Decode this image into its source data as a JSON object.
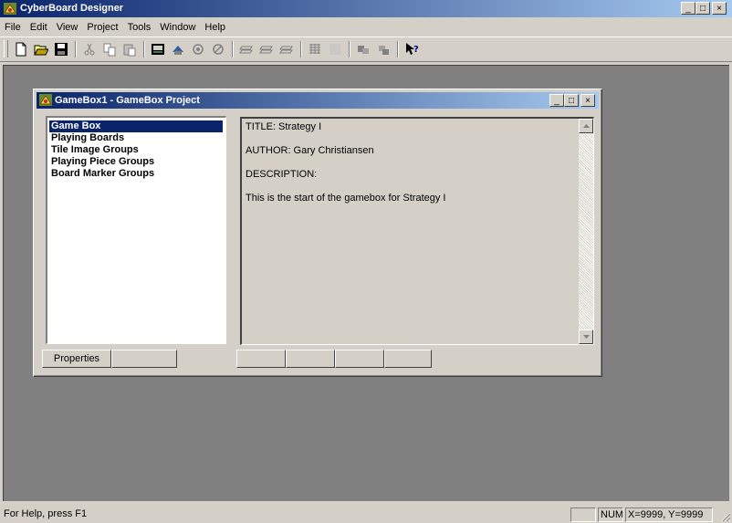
{
  "app": {
    "title": "CyberBoard Designer",
    "caption_buttons": {
      "minimize": "_",
      "maximize": "□",
      "close": "×"
    }
  },
  "menu": [
    "File",
    "Edit",
    "View",
    "Project",
    "Tools",
    "Window",
    "Help"
  ],
  "toolbar": {
    "buttons": [
      "new-icon",
      "open-icon",
      "save-icon",
      "cut-icon",
      "copy-icon",
      "paste-icon",
      "project-icon",
      "board-icon",
      "piece-icon",
      "marker-icon",
      "layer1-icon",
      "layer2-icon",
      "layer3-icon",
      "grid-icon",
      "fine-grid-icon",
      "select-icon",
      "move-icon",
      "help-context-icon"
    ]
  },
  "child_window": {
    "title": "GameBox1 - GameBox Project",
    "caption_buttons": {
      "minimize": "_",
      "maximize": "□",
      "close": "×"
    },
    "tree": [
      {
        "label": "Game Box",
        "selected": true
      },
      {
        "label": "Playing Boards",
        "selected": false
      },
      {
        "label": "Tile Image Groups",
        "selected": false
      },
      {
        "label": "Playing Piece Groups",
        "selected": false
      },
      {
        "label": "Board Marker Groups",
        "selected": false
      }
    ],
    "info": {
      "title_line": "TITLE: Strategy I",
      "author_line": "AUTHOR: Gary Christiansen",
      "description_label": "DESCRIPTION:",
      "description_text": "This is the start of the gamebox for Strategy I"
    },
    "left_buttons": [
      "Properties",
      ""
    ],
    "right_buttons": [
      "",
      "",
      "",
      ""
    ]
  },
  "status": {
    "help_text": "For Help, press F1",
    "num": "NUM",
    "coords": "X=9999, Y=9999"
  },
  "colors": {
    "titlebar_start": "#0a246a",
    "titlebar_end": "#a6caf0",
    "face": "#d4d0c8",
    "mdi_background": "#808080",
    "selection": "#0a246a"
  }
}
